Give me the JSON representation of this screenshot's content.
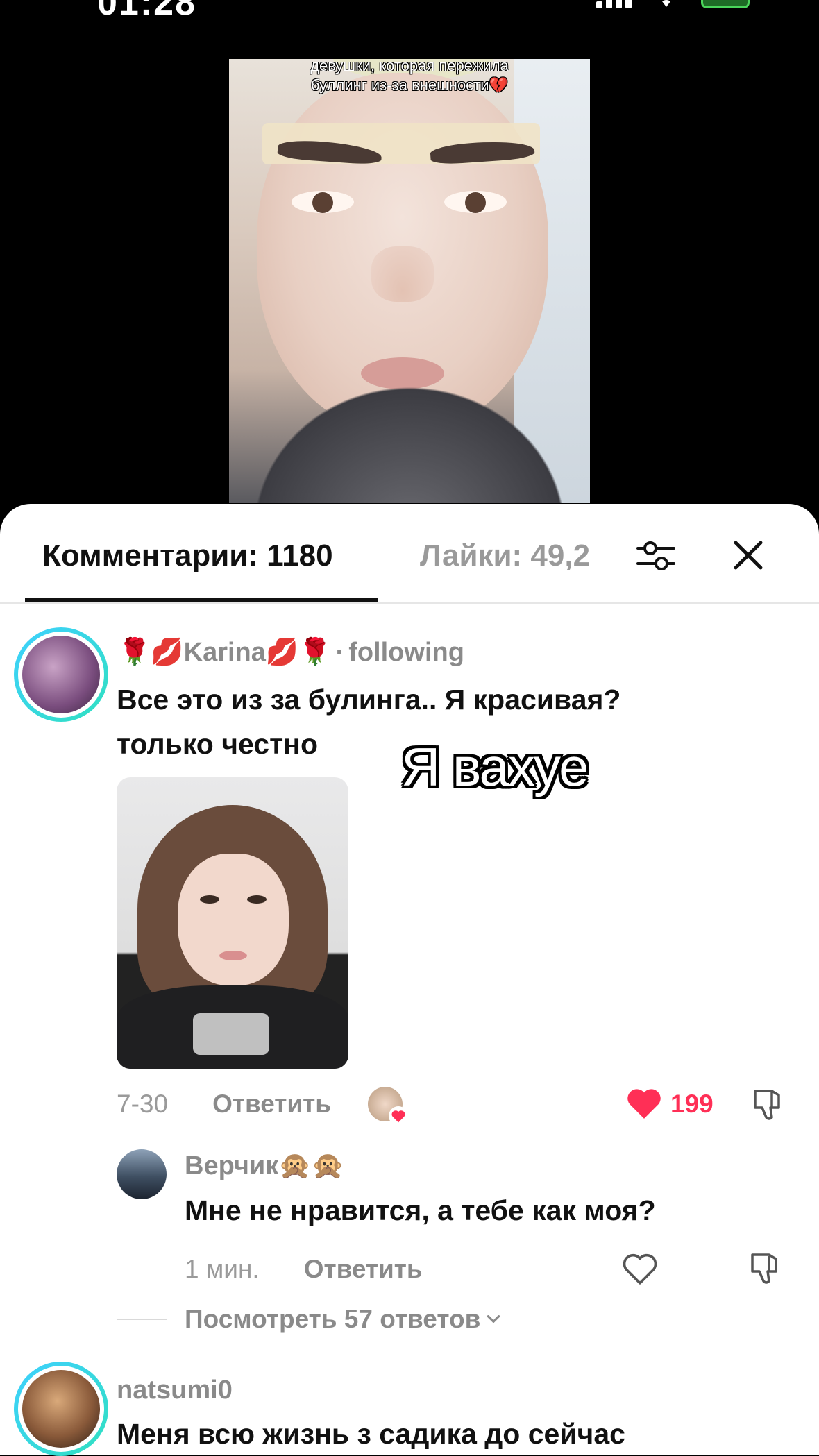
{
  "status_bar": {
    "time": "01:28"
  },
  "video": {
    "caption": "девушки, которая пережила буллинг из-за внешности💔"
  },
  "sheet": {
    "tab_comments": "Комментарии: 1180",
    "tab_likes": "Лайки: 49,2",
    "filter_icon": "filter-sliders-icon",
    "close_icon": "close-icon"
  },
  "comments": [
    {
      "username": "🌹💋Karina💋🌹",
      "tag_separator": "·",
      "tag": "following",
      "text": "Все это из за булинга.. Я красивая? только честно",
      "date": "7-30",
      "reply_label": "Ответить",
      "likes": "199",
      "liked": true
    },
    {
      "username": "Верчик🙊🙊",
      "text": "Мне не нравится, а тебе как моя?",
      "date": "1 мин.",
      "reply_label": "Ответить"
    },
    {
      "username": "natsumi0",
      "text": "Меня всю жизнь з садика до сейчас"
    }
  ],
  "overlay_text": "Я вахуе",
  "view_replies": "Посмотреть 57 ответов",
  "colors": {
    "like": "#ff2f56",
    "ring": "#3fd0ff"
  }
}
